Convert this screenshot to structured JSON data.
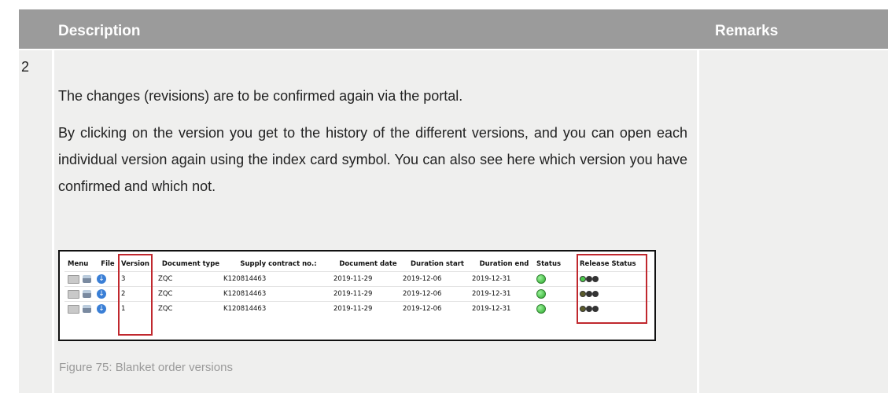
{
  "header": {
    "description": "Description",
    "remarks": "Remarks"
  },
  "row": {
    "number": "2",
    "paragraph1": "The changes (revisions) are to be confirmed again via the portal.",
    "paragraph2": "By clicking on the version you get to the history of the different versions, and you can open each individual version again using the index card symbol. You can also see here which version you have confirmed and which not.",
    "caption": "Figure 75: Blanket order versions"
  },
  "screenshot": {
    "columns": [
      "Menu",
      "File",
      "Version",
      "Document type",
      "Supply contract no.:",
      "Document date",
      "Duration start",
      "Duration end",
      "Status",
      "Release Status"
    ],
    "rows": [
      {
        "version": "3",
        "doc_type": "ZQC",
        "contract": "K120814463",
        "doc_date": "2019-11-29",
        "start": "2019-12-06",
        "end": "2019-12-31",
        "release_lights": [
          "#4cc94c",
          "#333333",
          "#333333"
        ]
      },
      {
        "version": "2",
        "doc_type": "ZQC",
        "contract": "K120814463",
        "doc_date": "2019-11-29",
        "start": "2019-12-06",
        "end": "2019-12-31",
        "release_lights": [
          "#5a5a2a",
          "#333333",
          "#333333"
        ]
      },
      {
        "version": "1",
        "doc_type": "ZQC",
        "contract": "K120814463",
        "doc_date": "2019-11-29",
        "start": "2019-12-06",
        "end": "2019-12-31",
        "release_lights": [
          "#5a5a2a",
          "#333333",
          "#333333"
        ]
      }
    ],
    "highlight_color": "#c0282e",
    "status_color": "#2aa82a"
  },
  "colors": {
    "header_bg": "#9b9b9b",
    "body_bg": "#efefee",
    "caption_color": "#9a9a9a"
  }
}
